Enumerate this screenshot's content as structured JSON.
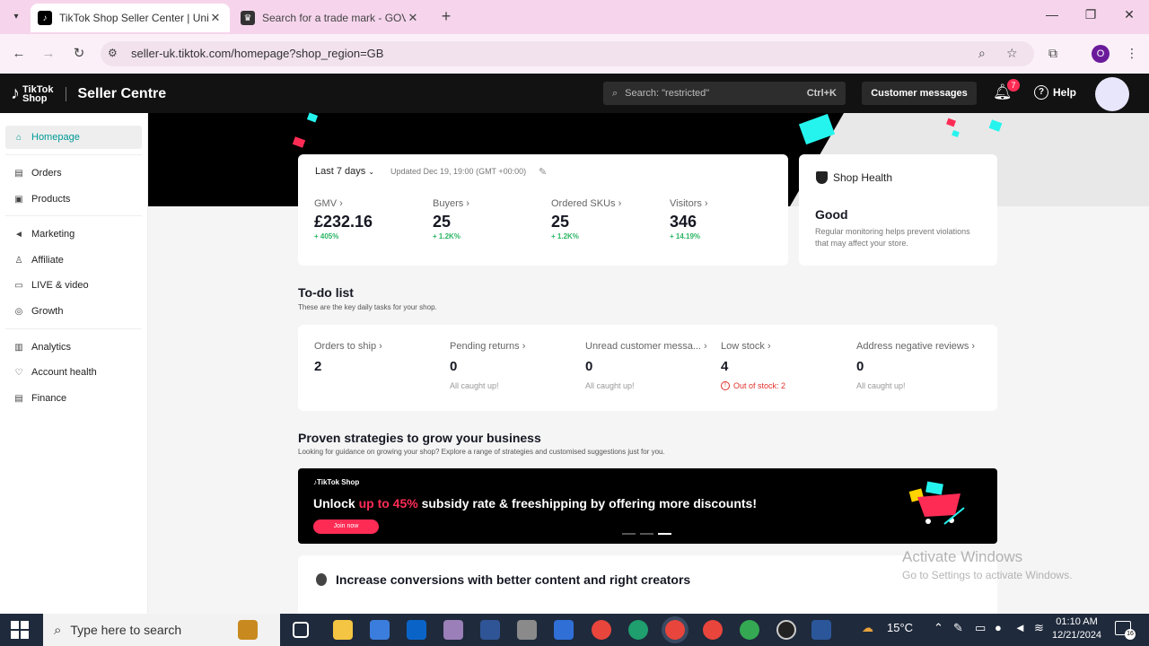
{
  "browser": {
    "tabs": [
      {
        "title": "TikTok Shop Seller Center | Unit",
        "active": true
      },
      {
        "title": "Search for a trade mark - GOV.U",
        "active": false
      }
    ],
    "url": "seller-uk.tiktok.com/homepage?shop_region=GB",
    "profile_initial": "O"
  },
  "header": {
    "brand_line1": "TikTok",
    "brand_line2": "Shop",
    "product": "Seller Centre",
    "search_placeholder": "Search: \"restricted\"",
    "search_shortcut": "Ctrl+K",
    "customer_messages": "Customer messages",
    "notification_count": "7",
    "help": "Help"
  },
  "sidebar": {
    "items": [
      {
        "label": "Homepage",
        "icon": "home-icon",
        "glyph": "⌂"
      },
      {
        "label": "Orders",
        "icon": "orders-icon",
        "glyph": "▤"
      },
      {
        "label": "Products",
        "icon": "products-icon",
        "glyph": "▣"
      },
      {
        "label": "Marketing",
        "icon": "megaphone-icon",
        "glyph": "◄"
      },
      {
        "label": "Affiliate",
        "icon": "people-icon",
        "glyph": "♙"
      },
      {
        "label": "LIVE & video",
        "icon": "video-icon",
        "glyph": "▭"
      },
      {
        "label": "Growth",
        "icon": "growth-icon",
        "glyph": "◎"
      },
      {
        "label": "Analytics",
        "icon": "analytics-icon",
        "glyph": "▥"
      },
      {
        "label": "Account health",
        "icon": "health-icon",
        "glyph": "♡"
      },
      {
        "label": "Finance",
        "icon": "finance-icon",
        "glyph": "▤"
      }
    ]
  },
  "kpis": {
    "period": "Last 7 days",
    "updated": "Updated Dec 19, 19:00 (GMT +00:00)",
    "items": [
      {
        "label": "GMV",
        "value": "£232.16",
        "change": "+ 405%"
      },
      {
        "label": "Buyers",
        "value": "25",
        "change": "+ 1.2K%"
      },
      {
        "label": "Ordered SKUs",
        "value": "25",
        "change": "+ 1.2K%"
      },
      {
        "label": "Visitors",
        "value": "346",
        "change": "+ 14.19%"
      }
    ]
  },
  "shop_health": {
    "title": "Shop Health",
    "status": "Good",
    "description": "Regular monitoring helps prevent violations that may affect your store."
  },
  "todo": {
    "title": "To-do list",
    "subtitle": "These are the key daily tasks for your shop.",
    "items": [
      {
        "label": "Orders to ship",
        "value": "2",
        "note": ""
      },
      {
        "label": "Pending returns",
        "value": "0",
        "note": "All caught up!"
      },
      {
        "label": "Unread customer messa...",
        "value": "0",
        "note": "All caught up!"
      },
      {
        "label": "Low stock",
        "value": "4",
        "note": "Out of stock: 2"
      },
      {
        "label": "Address negative reviews",
        "value": "0",
        "note": "All caught up!"
      }
    ]
  },
  "strategies": {
    "title": "Proven strategies to grow your business",
    "subtitle": "Looking for guidance on growing your shop? Explore a range of strategies and customised suggestions just for you.",
    "banner_brand": "TikTok Shop",
    "banner_text_pre": "Unlock ",
    "banner_text_highlight": "up to 45%",
    "banner_text_post": " subsidy rate & freeshipping by offering more discounts!",
    "banner_button": "Join now"
  },
  "conversions": {
    "title": "Increase conversions with better content and right creators"
  },
  "watermark": {
    "line1": "Activate Windows",
    "line2": "Go to Settings to activate Windows."
  },
  "taskbar": {
    "search_placeholder": "Type here to search",
    "temperature": "15°C",
    "time": "01:10 AM",
    "date": "12/21/2024",
    "notification_count": "16"
  },
  "colors": {
    "accent": "#009995",
    "brand_red": "#fe2c55",
    "positive": "#2ab563",
    "warning": "#e0302a"
  }
}
